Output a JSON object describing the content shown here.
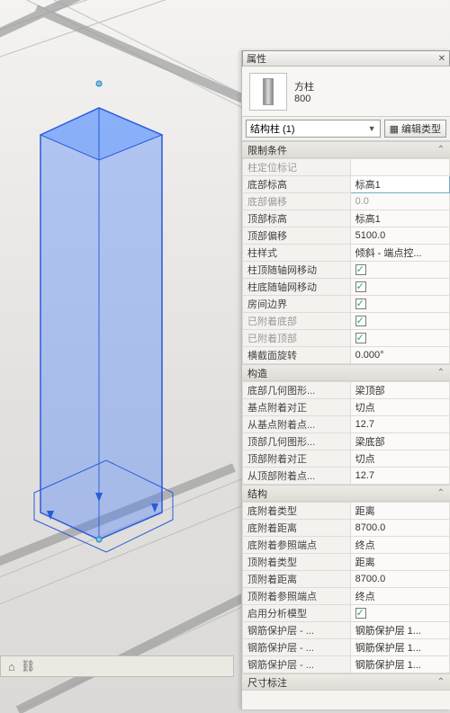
{
  "panel": {
    "title": "属性",
    "family": "方柱",
    "type": "800",
    "selector": "结构柱 (1)",
    "edit_type": "编辑类型"
  },
  "groups": [
    {
      "name": "限制条件",
      "rows": [
        {
          "k": "柱定位标记",
          "v": "",
          "ro": true
        },
        {
          "k": "底部标高",
          "v": "标高1",
          "sel": true
        },
        {
          "k": "底部偏移",
          "v": "0.0",
          "ro": true
        },
        {
          "k": "顶部标高",
          "v": "标高1"
        },
        {
          "k": "顶部偏移",
          "v": "5100.0"
        },
        {
          "k": "柱样式",
          "v": "倾斜 - 端点控..."
        },
        {
          "k": "柱顶随轴网移动",
          "v": "",
          "check": true,
          "checked": true
        },
        {
          "k": "柱底随轴网移动",
          "v": "",
          "check": true,
          "checked": true
        },
        {
          "k": "房间边界",
          "v": "",
          "check": true,
          "checked": true
        },
        {
          "k": "已附着底部",
          "v": "",
          "check": true,
          "checked": true,
          "ro": true
        },
        {
          "k": "已附着顶部",
          "v": "",
          "check": true,
          "checked": true,
          "ro": true
        },
        {
          "k": "横截面旋转",
          "v": "0.000°"
        }
      ]
    },
    {
      "name": "构造",
      "rows": [
        {
          "k": "底部几何图形...",
          "v": "梁顶部"
        },
        {
          "k": "基点附着对正",
          "v": "切点"
        },
        {
          "k": "从基点附着点...",
          "v": "12.7"
        },
        {
          "k": "顶部几何图形...",
          "v": "梁底部"
        },
        {
          "k": "顶部附着对正",
          "v": "切点"
        },
        {
          "k": "从顶部附着点...",
          "v": "12.7"
        }
      ]
    },
    {
      "name": "结构",
      "rows": [
        {
          "k": "底附着类型",
          "v": "距离"
        },
        {
          "k": "底附着距离",
          "v": "8700.0"
        },
        {
          "k": "底附着参照端点",
          "v": "终点"
        },
        {
          "k": "顶附着类型",
          "v": "距离"
        },
        {
          "k": "顶附着距离",
          "v": "8700.0"
        },
        {
          "k": "顶附着参照端点",
          "v": "终点"
        },
        {
          "k": "启用分析模型",
          "v": "",
          "check": true,
          "checked": true
        },
        {
          "k": "钢筋保护层 - ...",
          "v": "钢筋保护层 1..."
        },
        {
          "k": "钢筋保护层 - ...",
          "v": "钢筋保护层 1..."
        },
        {
          "k": "钢筋保护层 - ...",
          "v": "钢筋保护层 1..."
        }
      ]
    },
    {
      "name": "尺寸标注",
      "rows": []
    }
  ]
}
